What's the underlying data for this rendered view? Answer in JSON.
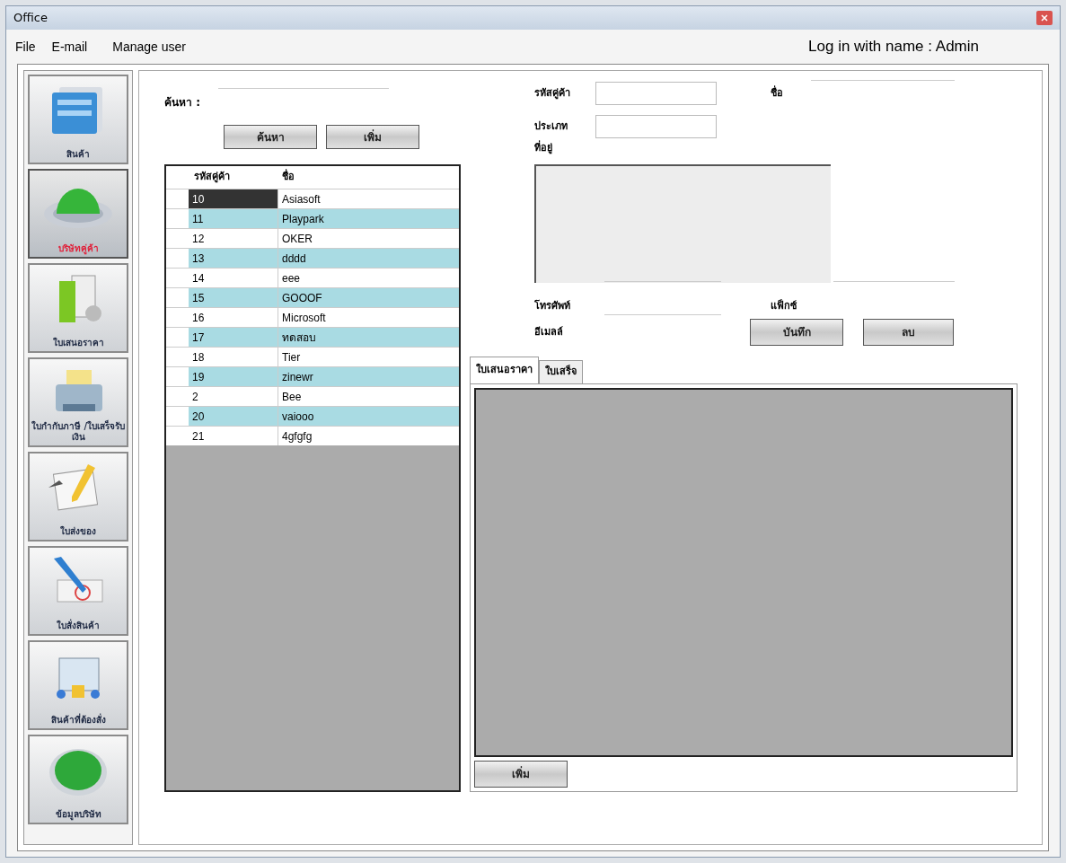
{
  "window": {
    "title": "Office"
  },
  "menu": [
    "File",
    "E-mail",
    "Manage user"
  ],
  "login_label": "Log in with name : Admin",
  "sidebar": [
    {
      "label": "สินค้า",
      "kind": "folder",
      "selected": false
    },
    {
      "label": "บริษัทคู่ค้า",
      "kind": "globe",
      "selected": true
    },
    {
      "label": "ใบเสนอราคา",
      "kind": "files",
      "selected": false
    },
    {
      "label": "ใบกำกับภาษี /ใบเสร็จรับเงิน",
      "kind": "printer",
      "selected": false
    },
    {
      "label": "ใบส่งของ",
      "kind": "pencil",
      "selected": false
    },
    {
      "label": "ใบสั่งสินค้า",
      "kind": "pen",
      "selected": false
    },
    {
      "label": "สินค้าที่ต้องสั่ง",
      "kind": "cart",
      "selected": false
    },
    {
      "label": "ข้อมูลบริษัท",
      "kind": "button",
      "selected": false
    }
  ],
  "search": {
    "label": "ค้นหา :",
    "buttons": [
      "ค้นหา",
      "เพิ่ม"
    ]
  },
  "grid": {
    "columns": [
      "รหัสคู่ค้า",
      "ชื่อ"
    ],
    "rows": [
      {
        "id": "10",
        "name": "Asiasoft",
        "selected": true
      },
      {
        "id": "11",
        "name": "Playpark",
        "selected": false
      },
      {
        "id": "12",
        "name": "OKER",
        "selected": false
      },
      {
        "id": "13",
        "name": "dddd",
        "selected": false
      },
      {
        "id": "14",
        "name": "eee",
        "selected": false
      },
      {
        "id": "15",
        "name": "GOOOF",
        "selected": false
      },
      {
        "id": "16",
        "name": "Microsoft",
        "selected": false
      },
      {
        "id": "17",
        "name": "ทดสอบ",
        "selected": false
      },
      {
        "id": "18",
        "name": "Tier",
        "selected": false
      },
      {
        "id": "19",
        "name": "zinewr",
        "selected": false
      },
      {
        "id": "2",
        "name": "Bee",
        "selected": false
      },
      {
        "id": "20",
        "name": "vaiooo",
        "selected": false
      },
      {
        "id": "21",
        "name": "4gfgfg",
        "selected": false
      }
    ]
  },
  "form": {
    "code": "รหัสคู่ค้า",
    "name": "ชื่อ",
    "type": "ประเภท",
    "address": "ที่อยู่",
    "phone": "โทรศัพท์",
    "fax": "แฟ็กซ์",
    "email": "อีเมลล์",
    "buttons": [
      "บันทึก",
      "ลบ"
    ]
  },
  "tabs": [
    {
      "label": "ใบเสนอราคา",
      "selected": true
    },
    {
      "label": "ใบเสร็จ",
      "selected": false
    }
  ],
  "tab_button": "เพิ่ม"
}
